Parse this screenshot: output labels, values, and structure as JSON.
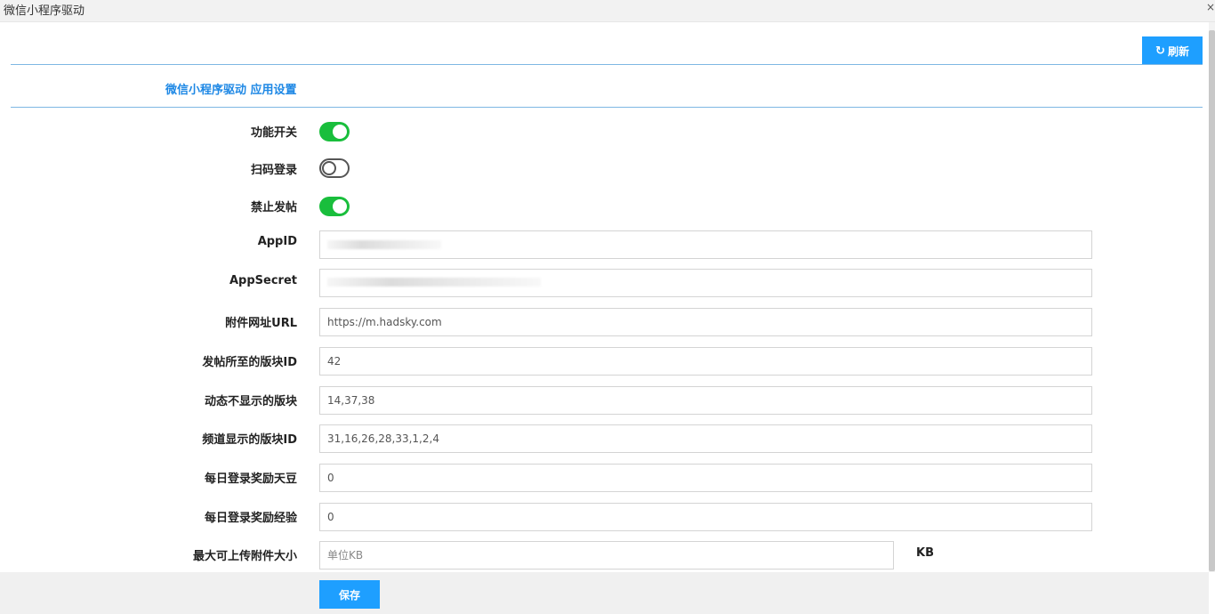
{
  "window": {
    "title": "微信小程序驱动",
    "close_glyph": "×"
  },
  "toolbar": {
    "refresh_icon": "↻",
    "refresh_label": "刷新"
  },
  "section": {
    "title": "微信小程序驱动 应用设置"
  },
  "toggles": [
    {
      "label": "功能开关",
      "state": "on"
    },
    {
      "label": "扫码登录",
      "state": "off"
    },
    {
      "label": "禁止发帖",
      "state": "on"
    }
  ],
  "fields": [
    {
      "label": "AppID",
      "value": "",
      "placeholder": ""
    },
    {
      "label": "AppSecret",
      "value": "",
      "placeholder": ""
    },
    {
      "label": "附件网址URL",
      "value": "https://m.hadsky.com",
      "placeholder": ""
    },
    {
      "label": "发帖所至的版块ID",
      "value": "42",
      "placeholder": ""
    },
    {
      "label": "动态不显示的版块",
      "value": "14,37,38",
      "placeholder": ""
    },
    {
      "label": "频道显示的版块ID",
      "value": "31,16,26,28,33,1,2,4",
      "placeholder": ""
    },
    {
      "label": "每日登录奖励天豆",
      "value": "0",
      "placeholder": ""
    },
    {
      "label": "每日登录奖励经验",
      "value": "0",
      "placeholder": ""
    },
    {
      "label": "最大可上传附件大小",
      "value": "",
      "placeholder": "单位KB",
      "unit": "KB"
    }
  ],
  "footer": {
    "save_label": "保存"
  },
  "colors": {
    "accent": "#1e9fff",
    "toggle_on": "#19be3c",
    "section_title": "#1e88e5"
  }
}
